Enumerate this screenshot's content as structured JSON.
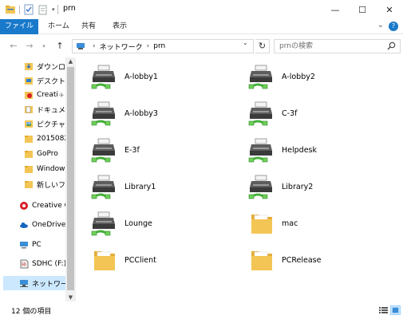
{
  "window": {
    "title": "prn",
    "minimize": "—",
    "maximize": "☐",
    "close": "✕"
  },
  "ribbon": {
    "tabs": [
      "ファイル",
      "ホーム",
      "共有",
      "表示"
    ],
    "help": "?"
  },
  "address": {
    "crumbs": [
      "ネットワーク",
      "prn"
    ],
    "separator": "›",
    "search_placeholder": "prnの検索"
  },
  "sidebar": {
    "items": [
      {
        "label": "ダウンロ",
        "icon": "download-folder-icon",
        "pinned": true
      },
      {
        "label": "デスクトッ",
        "icon": "desktop-folder-icon",
        "pinned": true
      },
      {
        "label": "Creati",
        "icon": "creative-cloud-folder-icon",
        "pinned": true
      },
      {
        "label": "ドキュメ",
        "icon": "documents-folder-icon",
        "pinned": true
      },
      {
        "label": "ピクチャ",
        "icon": "pictures-folder-icon",
        "pinned": true
      },
      {
        "label": "2015082",
        "icon": "folder-icon",
        "pinned": false
      },
      {
        "label": "GoPro",
        "icon": "folder-icon",
        "pinned": false
      },
      {
        "label": "Windows",
        "icon": "folder-icon",
        "pinned": false
      },
      {
        "label": "新しいフォ",
        "icon": "folder-icon",
        "pinned": false
      },
      {
        "label": "Creative C",
        "icon": "creative-cloud-icon",
        "pinned": false
      },
      {
        "label": "OneDrive",
        "icon": "onedrive-icon",
        "pinned": false
      },
      {
        "label": "PC",
        "icon": "pc-icon",
        "pinned": false
      },
      {
        "label": "SDHC (F:)",
        "icon": "sd-card-icon",
        "pinned": false
      },
      {
        "label": "ネットワーク",
        "icon": "network-icon",
        "pinned": false
      }
    ],
    "pin_glyph": "✈"
  },
  "content": {
    "items": [
      {
        "label": "A-lobby1",
        "type": "printer"
      },
      {
        "label": "A-lobby2",
        "type": "printer"
      },
      {
        "label": "A-lobby3",
        "type": "printer"
      },
      {
        "label": "C-3f",
        "type": "printer"
      },
      {
        "label": "E-3f",
        "type": "printer"
      },
      {
        "label": "Helpdesk",
        "type": "printer"
      },
      {
        "label": "Library1",
        "type": "printer"
      },
      {
        "label": "Library2",
        "type": "printer"
      },
      {
        "label": "Lounge",
        "type": "printer"
      },
      {
        "label": "mac",
        "type": "folder"
      },
      {
        "label": "PCClient",
        "type": "folder"
      },
      {
        "label": "PCRelease",
        "type": "folder"
      }
    ]
  },
  "status": {
    "count": "12 個の項目"
  },
  "colors": {
    "accent": "#1979ca",
    "selected": "#cce8ff",
    "folder": "#f3c554"
  }
}
